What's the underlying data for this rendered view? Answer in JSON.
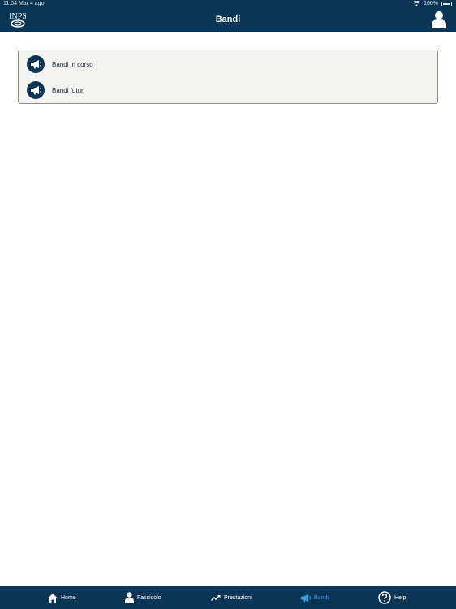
{
  "status_bar": {
    "time": "11:04",
    "date": "Mar 4 ago",
    "battery": "100%"
  },
  "header": {
    "title": "Bandi",
    "logo_text": "INPS"
  },
  "menu": {
    "items": [
      {
        "label": "Bandi in corso",
        "icon": "megaphone-icon"
      },
      {
        "label": "Bandi futuri",
        "icon": "megaphone-icon"
      }
    ]
  },
  "tabs": [
    {
      "label": "Home",
      "icon": "home-icon",
      "active": false
    },
    {
      "label": "Fascicolo",
      "icon": "person-icon",
      "active": false
    },
    {
      "label": "Prestazioni",
      "icon": "trend-icon",
      "active": false
    },
    {
      "label": "Bandi",
      "icon": "megaphone-icon",
      "active": true
    },
    {
      "label": "Help",
      "icon": "help-icon",
      "active": false
    }
  ],
  "colors": {
    "bar": "#0b3554",
    "active_tab": "#3a9be0",
    "card_bg": "#f3f3f1"
  }
}
